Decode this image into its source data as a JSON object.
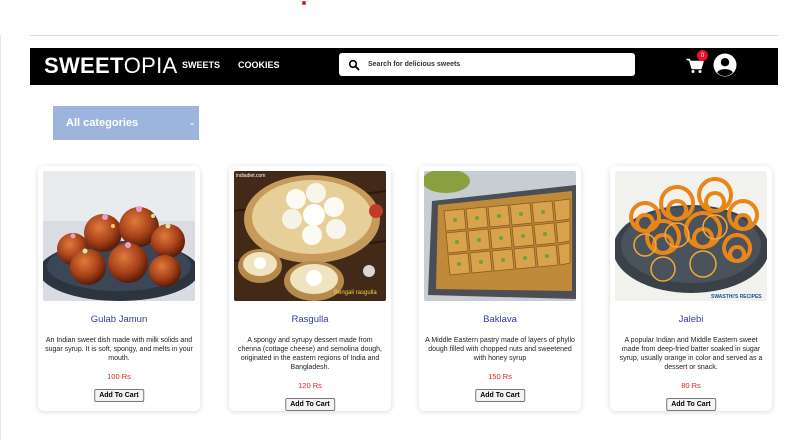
{
  "header": {
    "logo_bold": "SWEET",
    "logo_light": "OPIA",
    "nav": [
      "SWEETS",
      "COOKIES"
    ],
    "search_placeholder": "Search for delicious sweets",
    "cart_count": "0",
    "icons": [
      "search-icon",
      "cart-icon",
      "user-icon"
    ]
  },
  "filter": {
    "selected": "All categories"
  },
  "colors": {
    "navbar": "#000000",
    "accent_blue": "#2f3e9e",
    "price_red": "#e02020",
    "badge_red": "#e8102a",
    "select_bg": "#9db4dc"
  },
  "products": [
    {
      "name": "Gulab Jamun",
      "description": "An Indian sweet dish made with milk solids and sugar syrup. It is soft, spongy, and melts in your mouth.",
      "price": "100 Rs",
      "button": "Add To Cart"
    },
    {
      "name": "Rasgulla",
      "description": "A spongy and syrupy dessert made from chenna (cottage cheese) and semolina dough, originated in the eastern regions of India and Bangladesh.",
      "price": "120 Rs",
      "button": "Add To Cart",
      "image_caption": "Bengali rasgulla"
    },
    {
      "name": "Baklava",
      "description": "A Middle Eastern pastry made of layers of phyllo dough filled with chopped nuts and sweetened with honey syrup",
      "price": "150 Rs",
      "button": "Add To Cart"
    },
    {
      "name": "Jalebi",
      "description": "A popular Indian and Middle Eastern sweet made from deep-fried batter soaked in sugar syrup, usually orange in color and served as a dessert or snack.",
      "price": "80 Rs",
      "button": "Add To Cart",
      "image_caption": "SWASTHI'S RECIPES"
    }
  ]
}
